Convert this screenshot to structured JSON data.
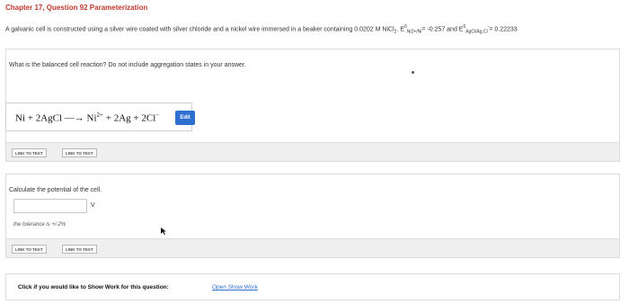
{
  "header": {
    "title": "Chapter 17, Question 92 Parameterization"
  },
  "problem": {
    "text_1": "A galvanic cell is constructed using a silver wire coated with silver chloride and a nickel wire immersed in a beaker containing 0.0202 M NiCl",
    "sub_1": "2",
    "text_2": ". E",
    "sup_1": "0",
    "sub_2": "Ni2+/Ni",
    "text_3": "= -0.257 and E",
    "sup_2": "0",
    "sub_3": "AgCl/Ag,Cl",
    "sup_3": "-",
    "text_4": "= 0.22233"
  },
  "part1": {
    "question": "What is the balanced cell reaction? Do not include aggregation states in your answer.",
    "equation": {
      "left": "Ni + 2AgCl",
      "arrow": "—→",
      "ni": "Ni",
      "ni_charge": "2+",
      "right": "+ 2Ag + 2Cl",
      "cl_charge": "−"
    },
    "edit_label": "Edit",
    "link_1": "LINK TO TEXT",
    "link_2": "LINK TO TEXT"
  },
  "part2": {
    "question": "Calculate the potential of the cell.",
    "input_value": "",
    "unit": "V",
    "tolerance": "the tolerance is +/-2%",
    "link_1": "LINK TO TEXT",
    "link_2": "LINK TO TEXT"
  },
  "footer": {
    "prompt": "Click if you would like to Show Work for this question:",
    "link": "Open Show Work"
  }
}
